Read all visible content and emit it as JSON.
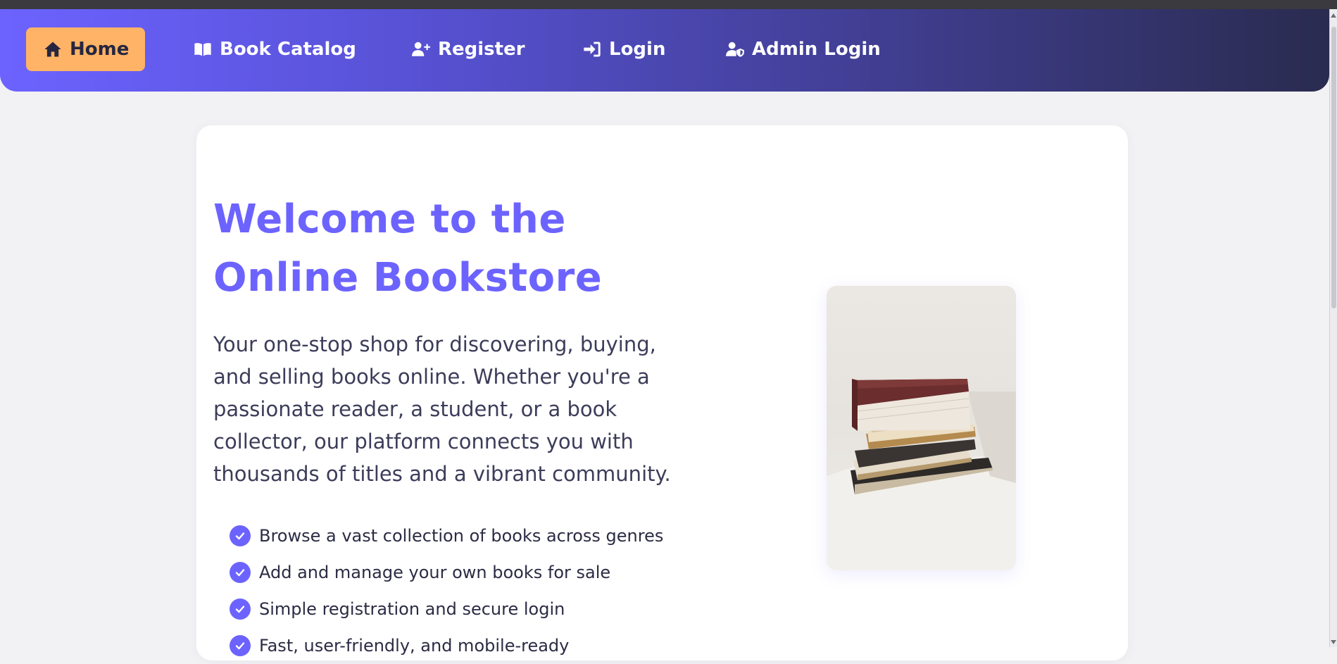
{
  "nav": {
    "items": [
      {
        "label": "Home",
        "icon": "home-icon",
        "active": true
      },
      {
        "label": "Book Catalog",
        "icon": "book-open-icon",
        "active": false
      },
      {
        "label": "Register",
        "icon": "user-plus-icon",
        "active": false
      },
      {
        "label": "Login",
        "icon": "sign-in-icon",
        "active": false
      },
      {
        "label": "Admin Login",
        "icon": "user-shield-icon",
        "active": false
      }
    ]
  },
  "hero": {
    "title": "Welcome to the Online Bookstore",
    "description": "Your one-stop shop for discovering, buying, and selling books online. Whether you're a passionate reader, a student, or a book collector, our platform connects you with thousands of titles and a vibrant community.",
    "features": [
      "Browse a vast collection of books across genres",
      "Add and manage your own books for sale",
      "Simple registration and secure login",
      "Fast, user-friendly, and mobile-ready"
    ],
    "image": {
      "subject": "stack of books"
    }
  },
  "colors": {
    "accent": "#6c63ff",
    "active_nav": "#ffb366",
    "nav_gradient_start": "#6c63ff",
    "nav_gradient_end": "#2a2b4f",
    "background": "#f2f2f4",
    "text": "#3c3c5a"
  }
}
